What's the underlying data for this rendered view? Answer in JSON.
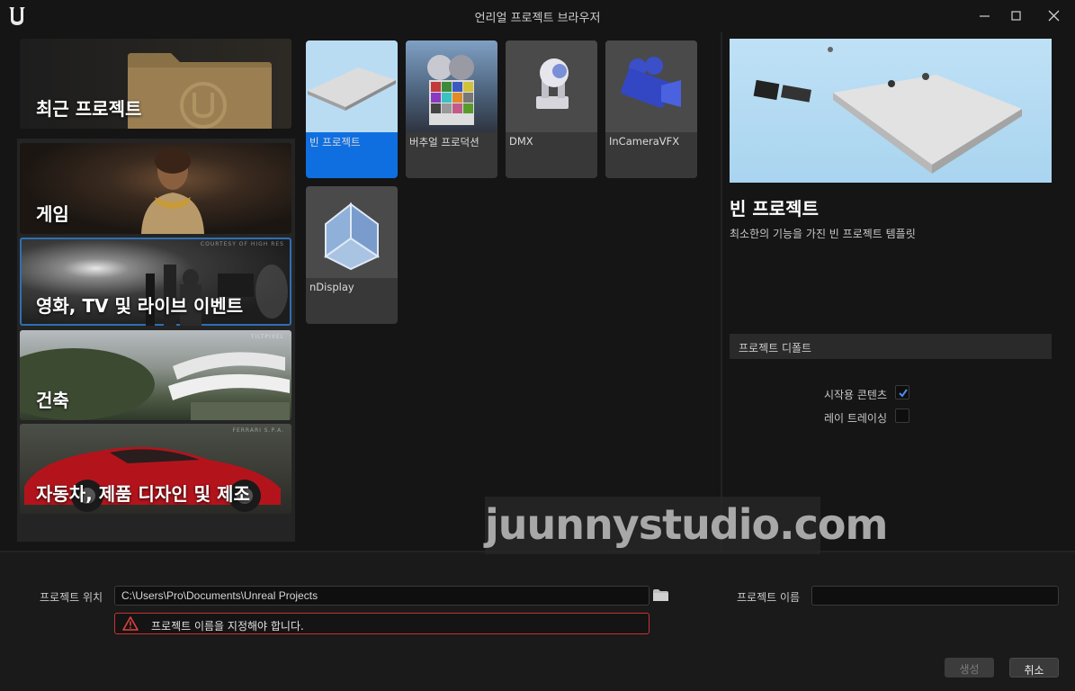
{
  "window": {
    "title": "언리얼 프로젝트 브라우저"
  },
  "categories": [
    {
      "label": "최근 프로젝트",
      "credit": ""
    },
    {
      "label": "게임",
      "credit": ""
    },
    {
      "label": "영화, TV 및 라이브 이벤트",
      "credit": "COURTESY OF HIGH RES"
    },
    {
      "label": "건축",
      "credit": "TILTPIXEL"
    },
    {
      "label": "자동차, 제품 디자인 및 제조",
      "credit": "FERRARI S.P.A."
    }
  ],
  "selected_category_index": 2,
  "templates": [
    {
      "name": "빈 프로젝트",
      "icon": "checker-plane-icon"
    },
    {
      "name": "버추얼 프로덕션",
      "icon": "color-chart-icon"
    },
    {
      "name": "DMX",
      "icon": "stage-light-icon"
    },
    {
      "name": "InCameraVFX",
      "icon": "camera-icon"
    },
    {
      "name": "nDisplay",
      "icon": "ndisplay-icon"
    }
  ],
  "selected_template_index": 0,
  "details": {
    "title": "빈 프로젝트",
    "description": "최소한의 기능을 가진 빈 프로젝트 템플릿",
    "defaults_header": "프로젝트 디폴트",
    "starter_content_label": "시작용 콘텐츠",
    "starter_content_checked": true,
    "ray_tracing_label": "레이 트레이싱",
    "ray_tracing_checked": false
  },
  "bottom": {
    "location_label": "프로젝트 위치",
    "location_value": "C:\\Users\\Pro\\Documents\\Unreal Projects",
    "name_label": "프로젝트 이름",
    "name_value": "",
    "error_text": "프로젝트 이름을 지정해야 합니다.",
    "create_label": "생성",
    "cancel_label": "취소"
  },
  "watermark": "juunnystudio.com",
  "colors": {
    "accent": "#0f6fe0",
    "error": "#c63333",
    "selection_outline": "#2f6fb2"
  }
}
